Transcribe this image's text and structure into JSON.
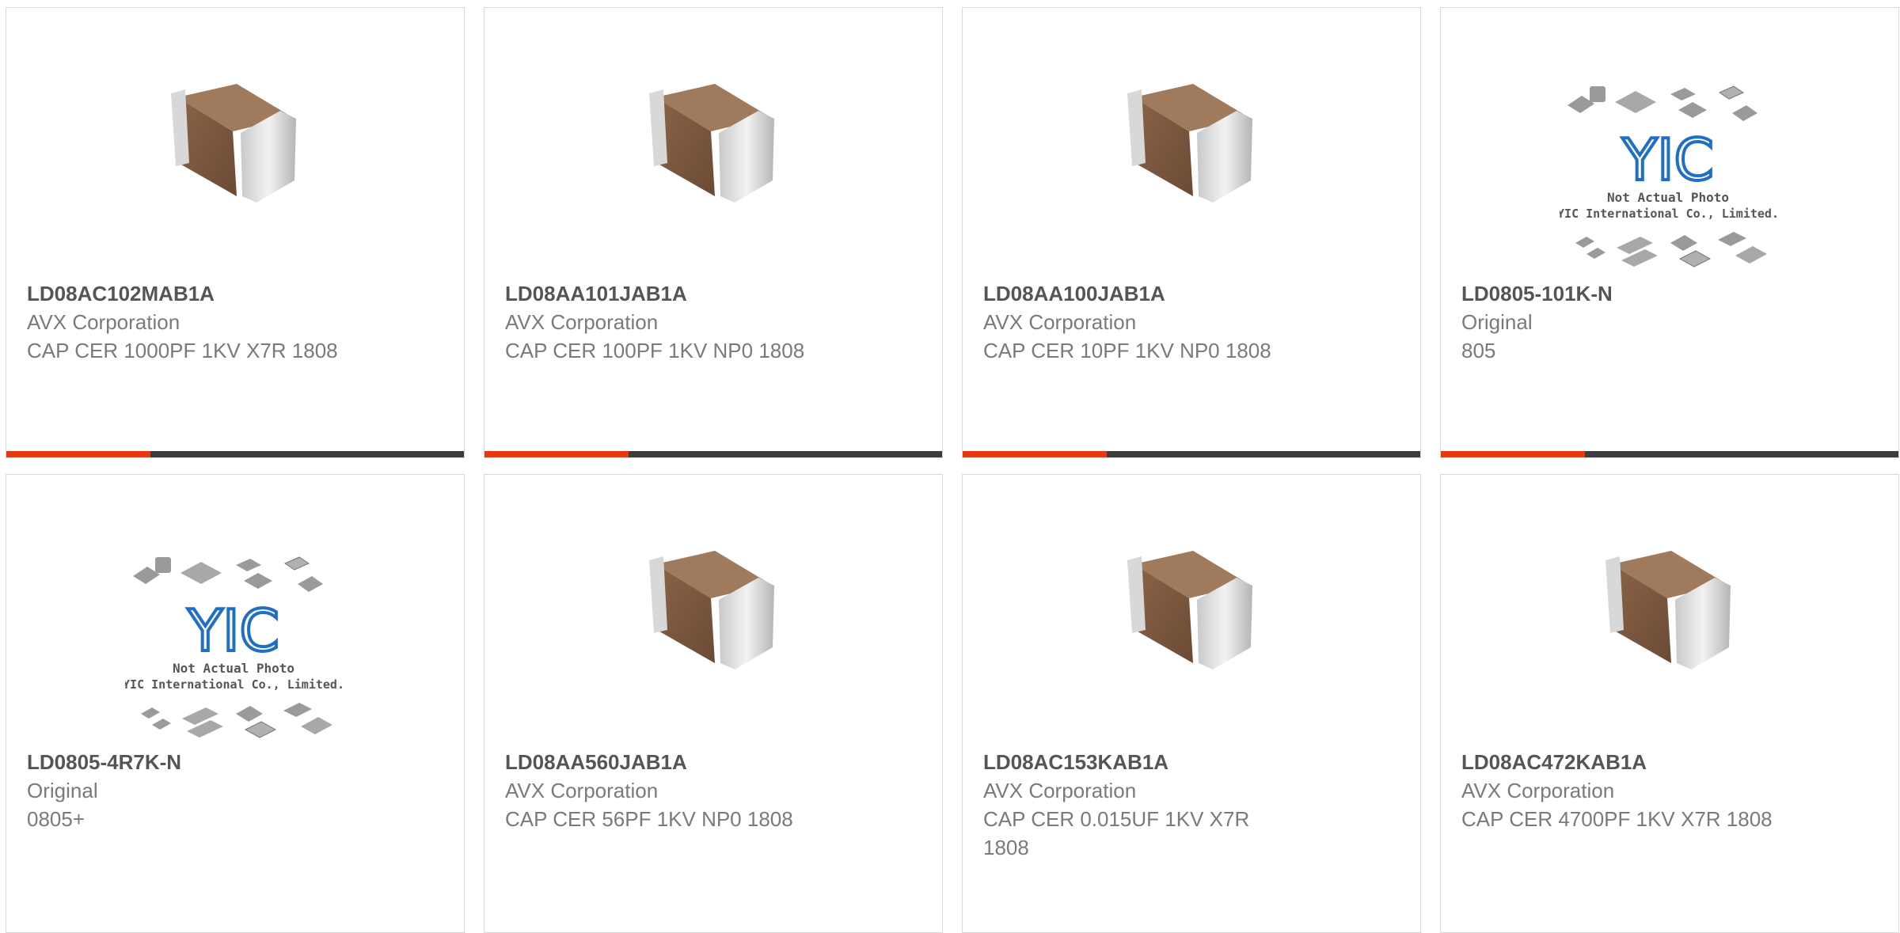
{
  "products": [
    {
      "part_number": "LD08AC102MAB1A",
      "manufacturer": "AVX Corporation",
      "description": "CAP CER 1000PF 1KV X7R 1808",
      "image": "ceramic-capacitor-photo"
    },
    {
      "part_number": "LD08AA101JAB1A",
      "manufacturer": "AVX Corporation",
      "description": "CAP CER 100PF 1KV NP0 1808",
      "image": "ceramic-capacitor-photo"
    },
    {
      "part_number": "LD08AA100JAB1A",
      "manufacturer": "AVX Corporation",
      "description": "CAP CER 10PF 1KV NP0 1808",
      "image": "ceramic-capacitor-photo"
    },
    {
      "part_number": "LD0805-101K-N",
      "manufacturer": "Original",
      "description": "805",
      "image": "placeholder-photo"
    },
    {
      "part_number": "LD0805-4R7K-N",
      "manufacturer": "Original",
      "description": "0805+",
      "image": "placeholder-photo"
    },
    {
      "part_number": "LD08AA560JAB1A",
      "manufacturer": "AVX Corporation",
      "description": "CAP CER 56PF 1KV NP0 1808",
      "image": "ceramic-capacitor-photo"
    },
    {
      "part_number": "LD08AC153KAB1A",
      "manufacturer": "AVX Corporation",
      "description": "CAP CER 0.015UF 1KV X7R 1808",
      "image": "ceramic-capacitor-photo"
    },
    {
      "part_number": "LD08AC472KAB1A",
      "manufacturer": "AVX Corporation",
      "description": "CAP CER 4700PF 1KV X7R 1808",
      "image": "ceramic-capacitor-photo"
    }
  ],
  "placeholder": {
    "brand": "YIC",
    "line1": "Not Actual Photo",
    "line2": "YIC International Co., Limited."
  },
  "colors": {
    "accent": "#e8380d",
    "bar_dark": "#3d3d3d",
    "part_number": "#555555",
    "secondary_text": "#7a7a7a",
    "yic_logo": "#1f6fc4"
  }
}
